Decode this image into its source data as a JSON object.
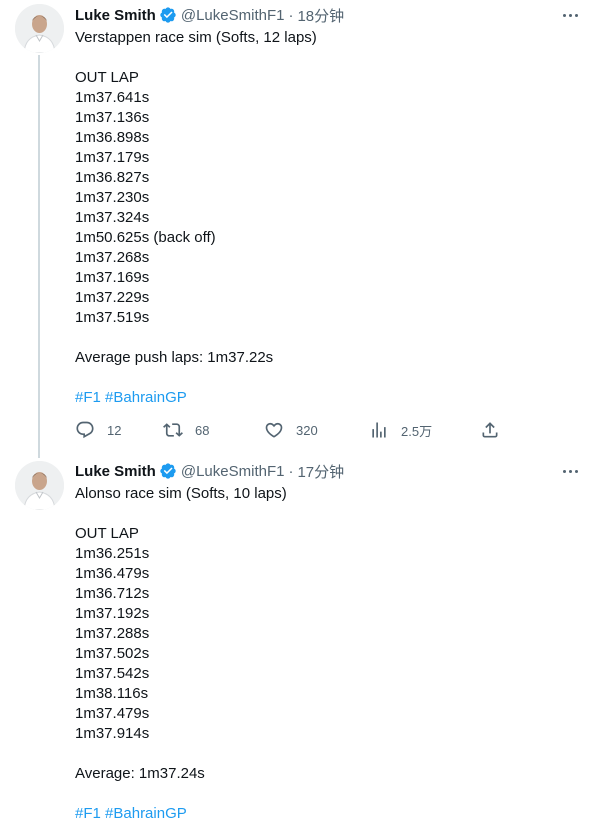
{
  "tweets": [
    {
      "author": {
        "name": "Luke Smith",
        "handle": "@LukeSmithF1",
        "verified": true,
        "avatar": "profile-photo"
      },
      "time": "18分钟",
      "text_lines": [
        "Verstappen race sim (Softs, 12 laps)",
        "",
        "OUT LAP",
        "1m37.641s",
        "1m37.136s",
        "1m36.898s",
        "1m37.179s",
        "1m36.827s",
        "1m37.230s",
        "1m37.324s",
        "1m50.625s (back off)",
        "1m37.268s",
        "1m37.169s",
        "1m37.229s",
        "1m37.519s",
        "",
        "Average push laps: 1m37.22s",
        ""
      ],
      "hashtags": [
        "#F1",
        "#BahrainGP"
      ],
      "metrics": {
        "replies": "12",
        "retweets": "68",
        "likes": "320",
        "views": "2.5万"
      }
    },
    {
      "author": {
        "name": "Luke Smith",
        "handle": "@LukeSmithF1",
        "verified": true,
        "avatar": "profile-photo"
      },
      "time": "17分钟",
      "text_lines": [
        "Alonso race sim (Softs, 10 laps)",
        "",
        "OUT LAP",
        "1m36.251s",
        "1m36.479s",
        "1m36.712s",
        "1m37.192s",
        "1m37.288s",
        "1m37.502s",
        "1m37.542s",
        "1m38.116s",
        "1m37.479s",
        "1m37.914s",
        "",
        "Average: 1m37.24s",
        ""
      ],
      "hashtags": [
        "#F1",
        "#BahrainGP"
      ]
    }
  ],
  "separator": "·",
  "icons": {
    "more": "more-horizontal-icon",
    "verified": "verified-badge-icon",
    "reply": "reply-icon",
    "retweet": "retweet-icon",
    "like": "heart-icon",
    "views": "views-chart-icon",
    "share": "share-icon"
  },
  "colors": {
    "text": "#0f1419",
    "secondary": "#536471",
    "link": "#1d9bf0",
    "verified": "#1d9bf0",
    "thread_line": "#cfd9de"
  }
}
